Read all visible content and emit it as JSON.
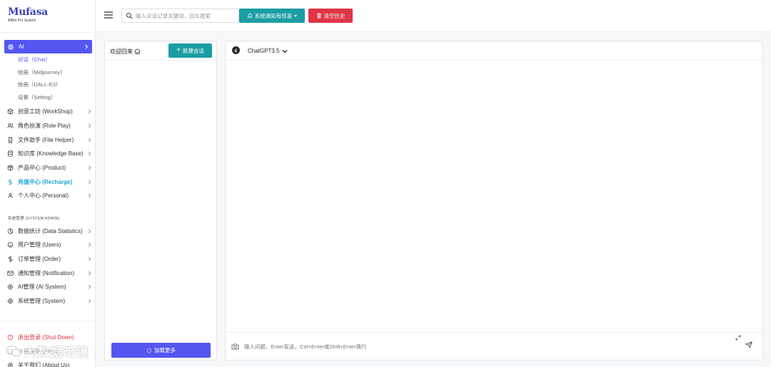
{
  "brand": {
    "title": "Mufasa",
    "subtitle": "AIBot Pro System"
  },
  "sidebar": {
    "active_item": {
      "label": "AI",
      "icon": "gear-icon"
    },
    "sub_items": [
      {
        "label": "对话（Chat）",
        "active": true
      },
      {
        "label": "绘画（Midjourney）"
      },
      {
        "label": "绘画（DALL-E3）"
      },
      {
        "label": "设置（Setting）"
      }
    ],
    "items": [
      {
        "label": "创意工坊 (WorkShop)",
        "icon": "cube-icon"
      },
      {
        "label": "角色扮演 (Role Play)",
        "icon": "users-icon"
      },
      {
        "label": "文件助手 (File Helper)",
        "icon": "file-icon"
      },
      {
        "label": "知识库 (Knowledge Base)",
        "icon": "database-icon"
      },
      {
        "label": "产品中心 (Product)",
        "icon": "package-icon"
      },
      {
        "label": "充值中心 (Recharge)",
        "icon": "dollar-icon",
        "highlight": true
      },
      {
        "label": "个人中心 (Personal)",
        "icon": "user-icon"
      }
    ],
    "admin_section_title": "系统管理 (SYSTEM ADMIN)",
    "admin_items": [
      {
        "label": "数据统计 (Data Statistics)",
        "icon": "pie-chart-icon"
      },
      {
        "label": "用户管理 (Users)",
        "icon": "smile-icon"
      },
      {
        "label": "订单管理 (Order)",
        "icon": "dollar-icon"
      },
      {
        "label": "通知管理 (Notification)",
        "icon": "mail-icon"
      },
      {
        "label": "AI管理 (AI System)",
        "icon": "gear-icon"
      },
      {
        "label": "系统管理 (System)",
        "icon": "gear-icon"
      }
    ],
    "bottom_items": [
      {
        "label": "退出登录 (Shut Down)",
        "icon": "power-icon"
      },
      {
        "label": "计费说明 (Price)",
        "icon": "info-icon"
      },
      {
        "label": "关于我们 (About Us)",
        "icon": "gear-icon"
      }
    ]
  },
  "header": {
    "search_placeholder": "输入对话记录关键词，回车搜索",
    "notify_label": "系统通知有惊喜",
    "clear_label": "清空历史"
  },
  "conversations": {
    "welcome": "欢迎回来",
    "new_label": "新建会话",
    "load_more": "加载更多"
  },
  "chat": {
    "model": "ChatGPT3.5",
    "input_placeholder": "输入问题，Enter发送，Ctrl+Enter或Shift+Enter换行"
  },
  "watermark": "大数据暗镜",
  "colors": {
    "primary": "#5456f0",
    "teal": "#1b9ea3",
    "danger": "#de3545",
    "recharge": "#1aa6d6"
  }
}
